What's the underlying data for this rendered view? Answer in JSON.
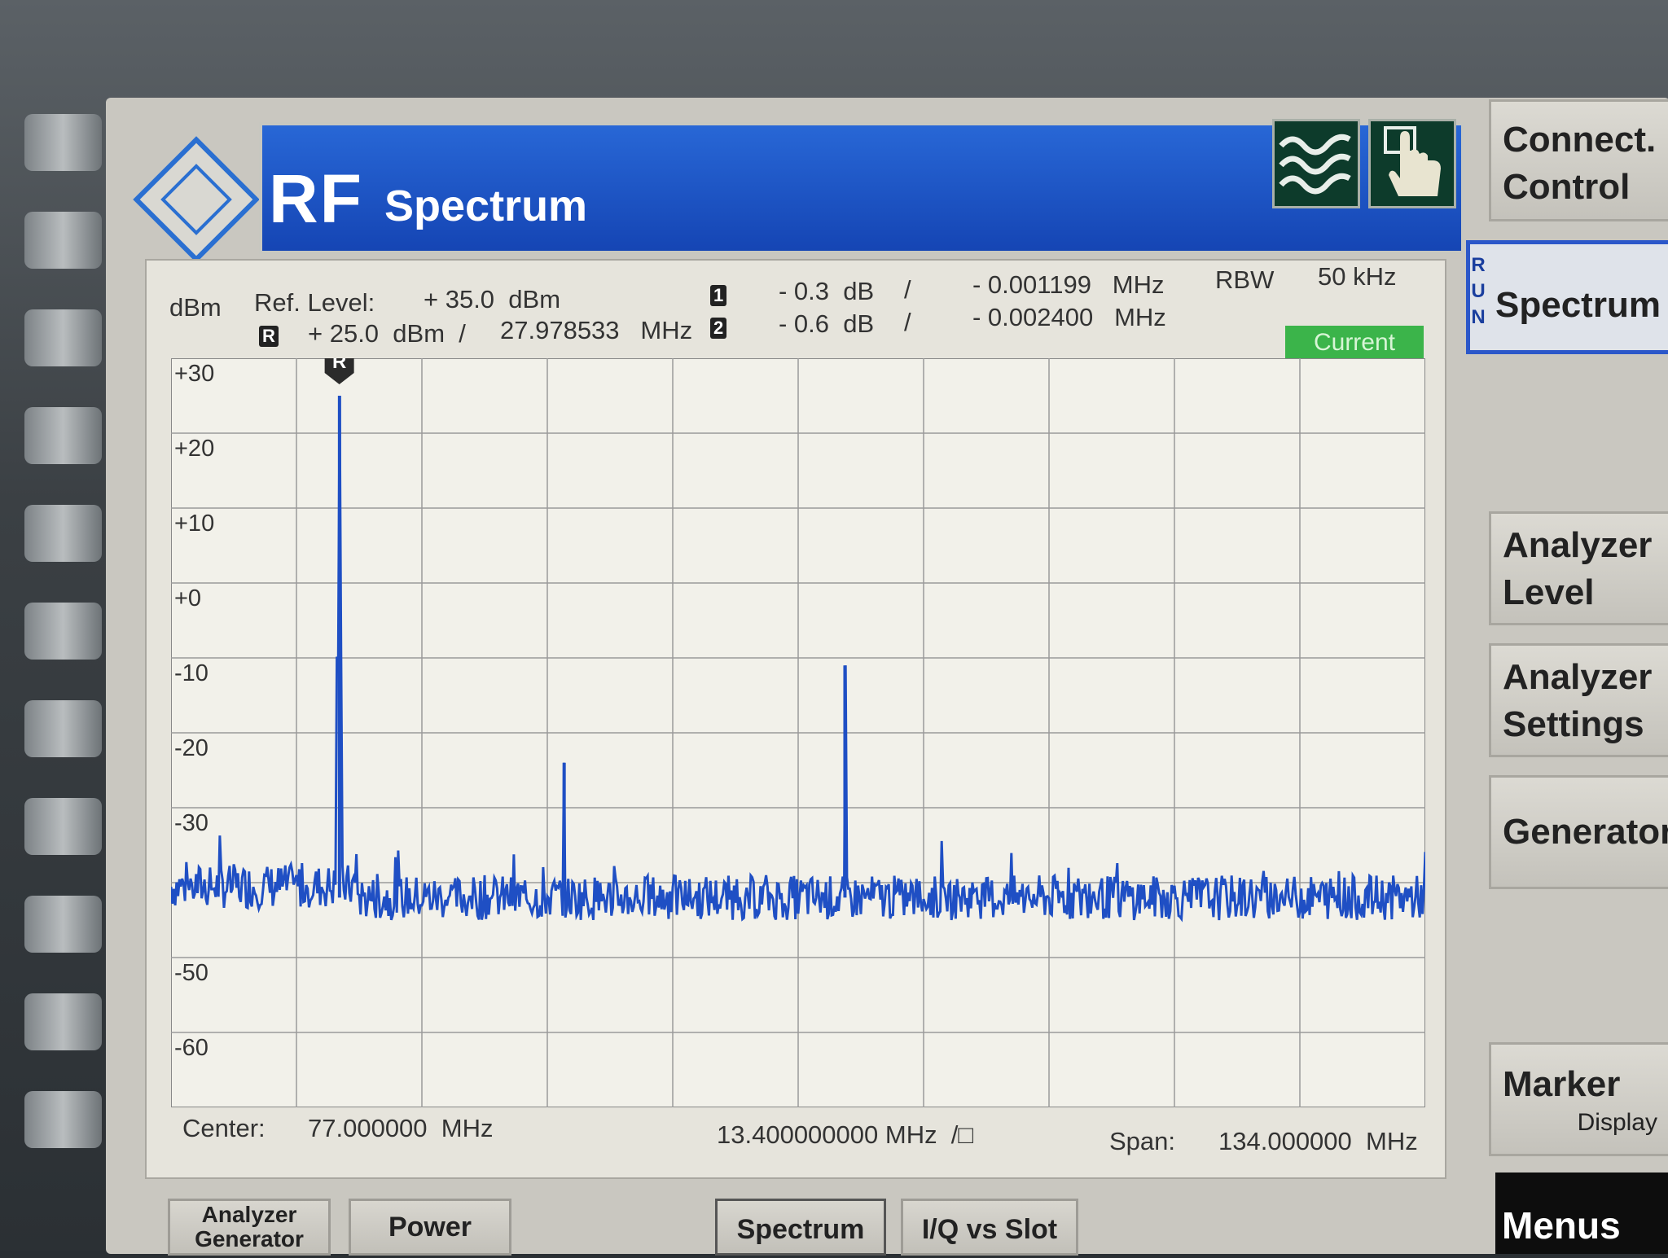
{
  "header": {
    "rf": "RF",
    "title": "Spectrum"
  },
  "panel": {
    "unit": "dBm",
    "ref_level_label": "Ref. Level:",
    "ref_level_value": "+ 35.0  dBm",
    "ref_marker_tag": "R",
    "ref_marker_level": "+ 25.0  dBm  /",
    "ref_marker_freq": "27.978533   MHz",
    "marker1_tag": "1",
    "marker1_level": "- 0.3  dB",
    "marker1_sep": "/",
    "marker1_freq": "- 0.001199   MHz",
    "marker2_tag": "2",
    "marker2_level": "- 0.6  dB",
    "marker2_sep": "/",
    "marker2_freq": "- 0.002400   MHz",
    "rbw_label": "RBW",
    "rbw_value": "50 kHz",
    "status": "Current"
  },
  "footer": {
    "center_label": "Center:",
    "center_value": "77.000000  MHz",
    "division": "13.400000000 MHz  /□",
    "span_label": "Span:",
    "span_value": "134.000000  MHz"
  },
  "softkeys": {
    "connect_1": "Connect.",
    "connect_2": "Control",
    "run_letters": [
      "R",
      "U",
      "N"
    ],
    "spectrum": "Spectrum",
    "analyzer_level_1": "Analyzer",
    "analyzer_level_2": "Level",
    "analyzer_settings_1": "Analyzer",
    "analyzer_settings_2": "Settings",
    "generator": "Generator",
    "marker": "Marker",
    "marker_sub": "Display",
    "menus": "Menus"
  },
  "tabs": {
    "analyzer_generator_1": "Analyzer",
    "analyzer_generator_2": "Generator",
    "power": "Power",
    "spectrum": "Spectrum",
    "iq_vs_slot": "I/Q vs Slot"
  },
  "colors": {
    "trace": "#1f4fc4",
    "grid": "#9a9a9a",
    "title_blue": "#1d55c8",
    "status_green": "#3bb44a"
  },
  "chart_data": {
    "type": "line",
    "xlabel": "",
    "ylabel": "dBm",
    "x_unit": "MHz",
    "xlim": [
      10,
      144
    ],
    "ylim": [
      -70,
      30
    ],
    "y_ticks": [
      "+30",
      "+20",
      "+10",
      "+0",
      "-10",
      "-20",
      "-30",
      "-50",
      "-60"
    ],
    "noise_floor_dbm": -42,
    "peaks": [
      {
        "x_mhz": 28.0,
        "y_dbm": 25
      },
      {
        "x_mhz": 52.0,
        "y_dbm": -24
      },
      {
        "x_mhz": 82.0,
        "y_dbm": -11
      }
    ],
    "ref_marker": {
      "label": "R",
      "x_mhz": 27.98,
      "y_dbm": 25
    }
  }
}
